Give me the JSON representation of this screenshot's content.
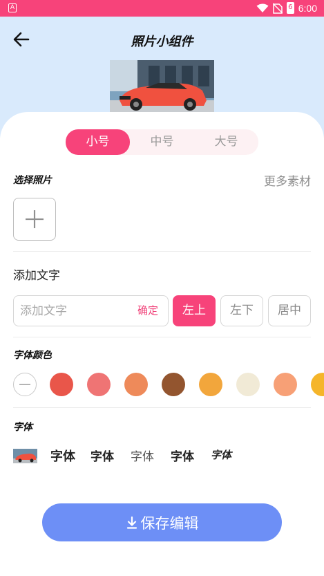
{
  "status_bar": {
    "time": "6:00",
    "app_icon_letter": "A",
    "battery_text": "6"
  },
  "header": {
    "title": "照片小组件"
  },
  "size_tabs": [
    {
      "label": "小号",
      "active": true
    },
    {
      "label": "中号",
      "active": false
    },
    {
      "label": "大号",
      "active": false
    }
  ],
  "photo_section": {
    "title": "选择照片",
    "more_label": "更多素材"
  },
  "text_section": {
    "title": "添加文字",
    "placeholder": "添加文字",
    "value": "",
    "confirm_label": "确定",
    "positions": [
      {
        "label": "左上",
        "active": true
      },
      {
        "label": "左下",
        "active": false
      },
      {
        "label": "居中",
        "active": false
      }
    ]
  },
  "color_section": {
    "title": "字体颜色",
    "colors": [
      "#e9564a",
      "#ef7474",
      "#ee8a5a",
      "#93552f",
      "#f2a63c",
      "#f1ead6",
      "#f7a076",
      "#f5b52a"
    ]
  },
  "font_section": {
    "title": "字体",
    "options": [
      "字体",
      "字体",
      "字体",
      "字体",
      "字体"
    ]
  },
  "save_button": {
    "label": "保存编辑"
  },
  "colors": {
    "accent_pink": "#f7437a",
    "save_blue": "#6d8ff6",
    "header_bg": "#d9eafc"
  }
}
